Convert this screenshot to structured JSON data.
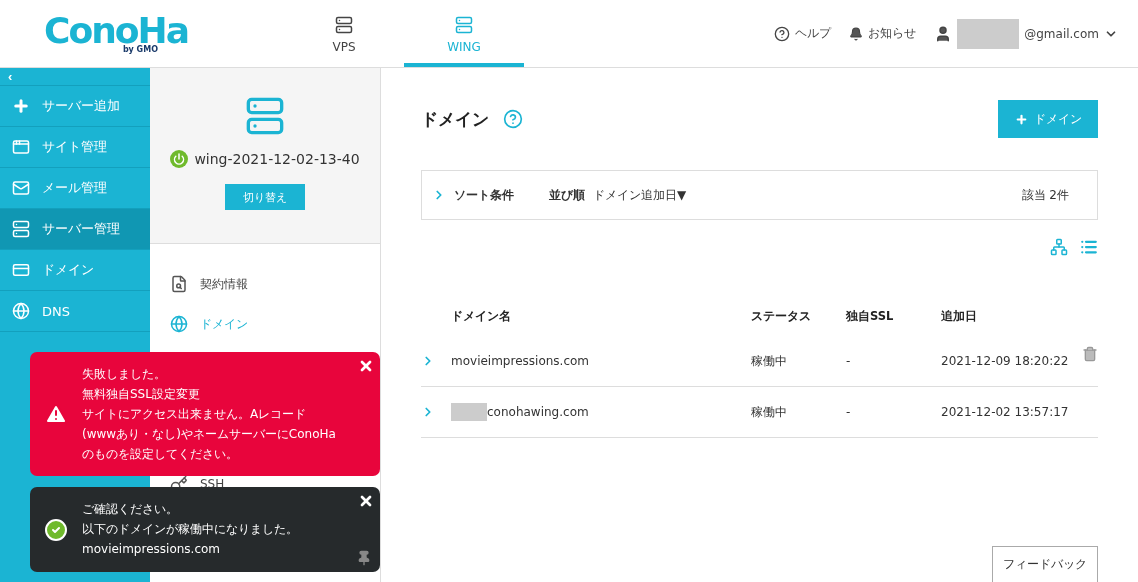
{
  "header": {
    "logo": "ConoHa",
    "logo_sub": "by GMO",
    "tabs": [
      {
        "label": "VPS",
        "selected": false
      },
      {
        "label": "WING",
        "selected": true
      }
    ],
    "help": "ヘルプ",
    "notice": "お知らせ",
    "account": "@gmail.com"
  },
  "sidebar": {
    "collapse": "‹",
    "items": [
      {
        "label": "サーバー追加",
        "selected": false
      },
      {
        "label": "サイト管理",
        "selected": false
      },
      {
        "label": "メール管理",
        "selected": false
      },
      {
        "label": "サーバー管理",
        "selected": true
      },
      {
        "label": "ドメイン",
        "selected": false
      },
      {
        "label": "DNS",
        "selected": false
      }
    ]
  },
  "server_panel": {
    "name": "wing-2021-12-02-13-40",
    "switch_button": "切り替え",
    "menu": [
      {
        "label": "契約情報",
        "selected": false
      },
      {
        "label": "ドメイン",
        "selected": true
      }
    ],
    "menu_lower": [
      {
        "label": "SSH",
        "selected": false
      }
    ]
  },
  "main": {
    "title": "ドメイン",
    "add_button": "ドメイン",
    "sort": {
      "label": "ソート条件",
      "order_label": "並び順",
      "order_value": "ドメイン追加日▼",
      "count": "該当 2件"
    },
    "table": {
      "columns": [
        "ドメイン名",
        "ステータス",
        "独自SSL",
        "追加日"
      ],
      "rows": [
        {
          "name": "movieimpressions.com",
          "redacted": false,
          "status": "稼働中",
          "ssl": "-",
          "date": "2021-12-09 18:20:22",
          "deletable": true
        },
        {
          "name": "conohawing.com",
          "redacted": true,
          "status": "稼働中",
          "ssl": "-",
          "date": "2021-12-02 13:57:17",
          "deletable": false
        }
      ]
    },
    "feedback": "フィードバック"
  },
  "toasts": [
    {
      "kind": "error",
      "lines": [
        "失敗しました。",
        "無料独自SSL設定変更",
        "サイトにアクセス出来ません。Aレコード",
        "(wwwあり・なし)やネームサーバーにConoHa",
        "のものを設定してください。"
      ],
      "pinned": false
    },
    {
      "kind": "success",
      "lines": [
        "ご確認ください。",
        "以下のドメインが稼働中になりました。",
        "movieimpressions.com"
      ],
      "pinned": true
    }
  ]
}
